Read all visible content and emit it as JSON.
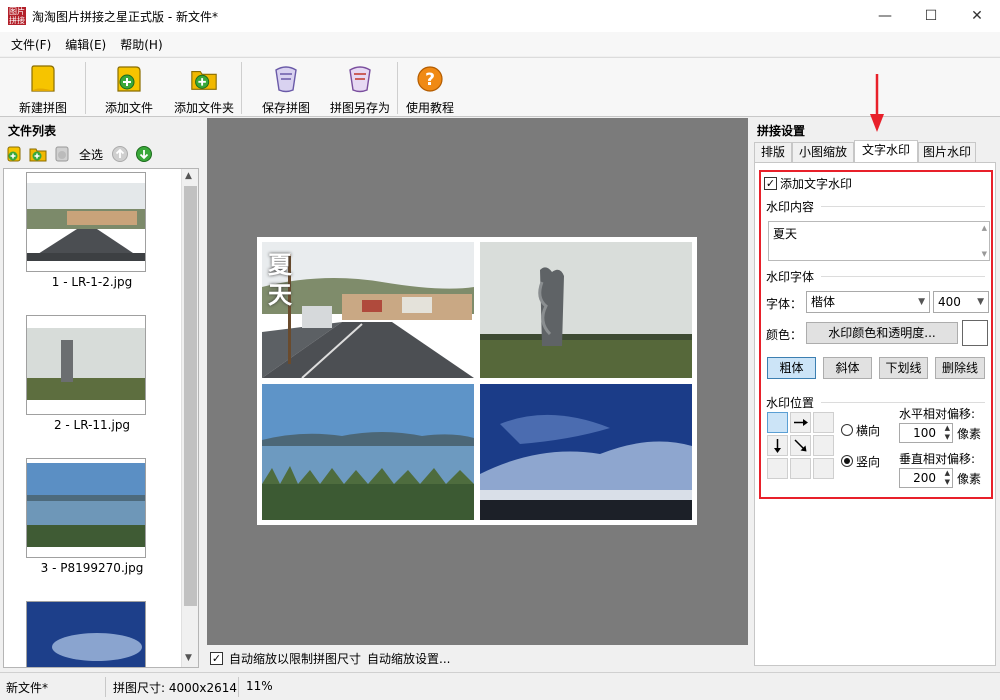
{
  "window": {
    "title": "淘淘图片拼接之星正式版 - 新文件*",
    "app_icon_text": "图片拼接",
    "minimize": "—",
    "maximize": "☐",
    "close": "✕"
  },
  "menu": [
    "文件(F)",
    "编辑(E)",
    "帮助(H)"
  ],
  "toolbar": {
    "new": "新建拼图",
    "add_file": "添加文件",
    "add_folder": "添加文件夹",
    "save": "保存拼图",
    "save_as": "拼图另存为",
    "tutorial": "使用教程"
  },
  "file_list": {
    "title": "文件列表",
    "select_all": "全选",
    "items": [
      {
        "caption": "1 - LR-1-2.jpg"
      },
      {
        "caption": "2 - LR-11.jpg"
      },
      {
        "caption": "3 - P8199270.jpg"
      },
      {
        "caption": ""
      }
    ]
  },
  "canvas": {
    "collage_text_1": "夏天",
    "auto_scale_label": "自动缩放以限制拼图尺寸",
    "auto_scale_settings": "自动缩放设置..."
  },
  "settings": {
    "title": "拼接设置",
    "tabs": [
      "排版",
      "小图缩放",
      "文字水印",
      "图片水印"
    ],
    "active_tab": 2,
    "add_text_watermark": "添加文字水印",
    "content_group": "水印内容",
    "content_value": "夏天",
    "font_group": "水印字体",
    "font_label": "字体：",
    "font_value": "楷体",
    "size_value": "400",
    "color_label": "颜色：",
    "color_button": "水印颜色和透明度...",
    "style_buttons": [
      "粗体",
      "斜体",
      "下划线",
      "删除线"
    ],
    "position_group": "水印位置",
    "horizontal": "横向",
    "vertical": "竖向",
    "h_offset_label": "水平相对偏移:",
    "h_offset_value": "100",
    "v_offset_label": "垂直相对偏移:",
    "v_offset_value": "200",
    "unit": "像素"
  },
  "status": {
    "file": "新文件*",
    "size": "拼图尺寸: 4000x2614",
    "zoom": "11%"
  },
  "colors": {
    "highlight": "#e8202a",
    "canvas_bg": "#7b7b7b"
  }
}
